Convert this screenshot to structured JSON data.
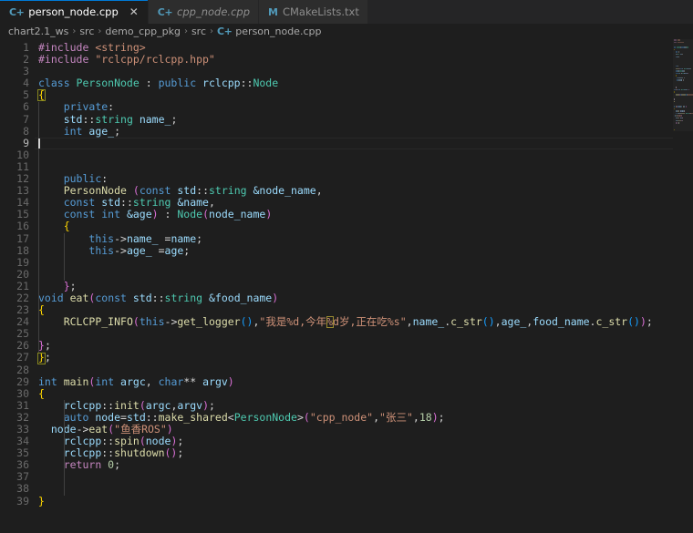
{
  "tabs": [
    {
      "label": "person_node.cpp",
      "icon": "cpp-file-icon",
      "icon_glyph": "C+",
      "active": true,
      "italic": false,
      "close": "✕"
    },
    {
      "label": "cpp_node.cpp",
      "icon": "cpp-file-icon",
      "icon_glyph": "C+",
      "active": false,
      "italic": true,
      "close": ""
    },
    {
      "label": "CMakeLists.txt",
      "icon": "cmake-file-icon",
      "icon_glyph": "M",
      "active": false,
      "italic": false,
      "close": ""
    }
  ],
  "breadcrumb": {
    "separator": "›",
    "items": [
      {
        "label": "chart2.1_ws",
        "icon": ""
      },
      {
        "label": "src",
        "icon": ""
      },
      {
        "label": "demo_cpp_pkg",
        "icon": ""
      },
      {
        "label": "src",
        "icon": ""
      },
      {
        "label": "person_node.cpp",
        "icon": "cpp-file-icon"
      }
    ]
  },
  "editor": {
    "language": "cpp",
    "file_name": "person_node.cpp",
    "current_line": 9,
    "total_lines": 39,
    "lines": [
      {
        "n": 1,
        "tokens": [
          {
            "t": "#include ",
            "c": "c-pre"
          },
          {
            "t": "<string>",
            "c": "c-str"
          }
        ]
      },
      {
        "n": 2,
        "tokens": [
          {
            "t": "#include ",
            "c": "c-pre"
          },
          {
            "t": "\"rclcpp/rclcpp.hpp\"",
            "c": "c-str"
          }
        ]
      },
      {
        "n": 3,
        "tokens": []
      },
      {
        "n": 4,
        "tokens": [
          {
            "t": "class ",
            "c": "c-key"
          },
          {
            "t": "PersonNode ",
            "c": "c-type"
          },
          {
            "t": ": ",
            "c": "c-plain"
          },
          {
            "t": "public ",
            "c": "c-key"
          },
          {
            "t": "rclcpp",
            "c": "c-id"
          },
          {
            "t": "::",
            "c": "c-plain"
          },
          {
            "t": "Node",
            "c": "c-type"
          }
        ]
      },
      {
        "n": 5,
        "tokens": [
          {
            "t": "{",
            "c": "c-brace"
          }
        ]
      },
      {
        "n": 6,
        "tokens": [
          {
            "t": "    ",
            "c": "c-plain"
          },
          {
            "t": "private",
            "c": "c-key"
          },
          {
            "t": ":",
            "c": "c-plain"
          }
        ]
      },
      {
        "n": 7,
        "tokens": [
          {
            "t": "    ",
            "c": "c-plain"
          },
          {
            "t": "std",
            "c": "c-id"
          },
          {
            "t": "::",
            "c": "c-plain"
          },
          {
            "t": "string ",
            "c": "c-type"
          },
          {
            "t": "name_",
            "c": "c-id"
          },
          {
            "t": ";",
            "c": "c-plain"
          }
        ]
      },
      {
        "n": 8,
        "tokens": [
          {
            "t": "    ",
            "c": "c-plain"
          },
          {
            "t": "int ",
            "c": "c-key"
          },
          {
            "t": "age_",
            "c": "c-id"
          },
          {
            "t": ";",
            "c": "c-plain"
          }
        ]
      },
      {
        "n": 9,
        "tokens": []
      },
      {
        "n": 10,
        "tokens": []
      },
      {
        "n": 11,
        "tokens": []
      },
      {
        "n": 12,
        "tokens": [
          {
            "t": "    ",
            "c": "c-plain"
          },
          {
            "t": "public",
            "c": "c-key"
          },
          {
            "t": ":",
            "c": "c-plain"
          }
        ]
      },
      {
        "n": 13,
        "tokens": [
          {
            "t": "    ",
            "c": "c-plain"
          },
          {
            "t": "PersonNode ",
            "c": "c-fn"
          },
          {
            "t": "(",
            "c": "c-paren"
          },
          {
            "t": "const ",
            "c": "c-key"
          },
          {
            "t": "std",
            "c": "c-id"
          },
          {
            "t": "::",
            "c": "c-plain"
          },
          {
            "t": "string ",
            "c": "c-type"
          },
          {
            "t": "&node_name",
            "c": "c-id"
          },
          {
            "t": ",",
            "c": "c-plain"
          }
        ]
      },
      {
        "n": 14,
        "tokens": [
          {
            "t": "    ",
            "c": "c-plain"
          },
          {
            "t": "const ",
            "c": "c-key"
          },
          {
            "t": "std",
            "c": "c-id"
          },
          {
            "t": "::",
            "c": "c-plain"
          },
          {
            "t": "string ",
            "c": "c-type"
          },
          {
            "t": "&name",
            "c": "c-id"
          },
          {
            "t": ",",
            "c": "c-plain"
          }
        ]
      },
      {
        "n": 15,
        "tokens": [
          {
            "t": "    ",
            "c": "c-plain"
          },
          {
            "t": "const ",
            "c": "c-key"
          },
          {
            "t": "int ",
            "c": "c-key"
          },
          {
            "t": "&age",
            "c": "c-id"
          },
          {
            "t": ") ",
            "c": "c-paren"
          },
          {
            "t": ": ",
            "c": "c-plain"
          },
          {
            "t": "Node",
            "c": "c-type"
          },
          {
            "t": "(",
            "c": "c-paren"
          },
          {
            "t": "node_name",
            "c": "c-id"
          },
          {
            "t": ")",
            "c": "c-paren"
          }
        ]
      },
      {
        "n": 16,
        "tokens": [
          {
            "t": "    ",
            "c": "c-plain"
          },
          {
            "t": "{",
            "c": "c-brace"
          }
        ]
      },
      {
        "n": 17,
        "tokens": [
          {
            "t": "        ",
            "c": "c-plain"
          },
          {
            "t": "this",
            "c": "c-key"
          },
          {
            "t": "->",
            "c": "c-plain"
          },
          {
            "t": "name_ ",
            "c": "c-id"
          },
          {
            "t": "=",
            "c": "c-plain"
          },
          {
            "t": "name",
            "c": "c-id"
          },
          {
            "t": ";",
            "c": "c-plain"
          }
        ]
      },
      {
        "n": 18,
        "tokens": [
          {
            "t": "        ",
            "c": "c-plain"
          },
          {
            "t": "this",
            "c": "c-key"
          },
          {
            "t": "->",
            "c": "c-plain"
          },
          {
            "t": "age_ ",
            "c": "c-id"
          },
          {
            "t": "=",
            "c": "c-plain"
          },
          {
            "t": "age",
            "c": "c-id"
          },
          {
            "t": ";",
            "c": "c-plain"
          }
        ]
      },
      {
        "n": 19,
        "tokens": []
      },
      {
        "n": 20,
        "tokens": []
      },
      {
        "n": 21,
        "tokens": [
          {
            "t": "    ",
            "c": "c-plain"
          },
          {
            "t": "}",
            "c": "c-paren"
          },
          {
            "t": ";",
            "c": "c-plain"
          }
        ]
      },
      {
        "n": 22,
        "tokens": [
          {
            "t": "void ",
            "c": "c-key"
          },
          {
            "t": "eat",
            "c": "c-fn"
          },
          {
            "t": "(",
            "c": "c-paren"
          },
          {
            "t": "const ",
            "c": "c-key"
          },
          {
            "t": "std",
            "c": "c-id"
          },
          {
            "t": "::",
            "c": "c-plain"
          },
          {
            "t": "string ",
            "c": "c-type"
          },
          {
            "t": "&food_name",
            "c": "c-id"
          },
          {
            "t": ")",
            "c": "c-paren"
          }
        ]
      },
      {
        "n": 23,
        "tokens": [
          {
            "t": "{",
            "c": "c-brace"
          }
        ]
      },
      {
        "n": 24,
        "tokens": [
          {
            "t": "    ",
            "c": "c-plain"
          },
          {
            "t": "RCLCPP_INFO",
            "c": "c-macro"
          },
          {
            "t": "(",
            "c": "c-paren"
          },
          {
            "t": "this",
            "c": "c-key"
          },
          {
            "t": "->",
            "c": "c-plain"
          },
          {
            "t": "get_logger",
            "c": "c-fn"
          },
          {
            "t": "()",
            "c": "c-paren2"
          },
          {
            "t": ",",
            "c": "c-plain"
          },
          {
            "t": "\"我是%d,今年%d岁,正在吃%s\"",
            "c": "c-str"
          },
          {
            "t": ",",
            "c": "c-plain"
          },
          {
            "t": "name_",
            "c": "c-id"
          },
          {
            "t": ".",
            "c": "c-plain"
          },
          {
            "t": "c_str",
            "c": "c-fn"
          },
          {
            "t": "()",
            "c": "c-paren2"
          },
          {
            "t": ",",
            "c": "c-plain"
          },
          {
            "t": "age_",
            "c": "c-id"
          },
          {
            "t": ",",
            "c": "c-plain"
          },
          {
            "t": "food_name",
            "c": "c-id"
          },
          {
            "t": ".",
            "c": "c-plain"
          },
          {
            "t": "c_str",
            "c": "c-fn"
          },
          {
            "t": "()",
            "c": "c-paren2"
          },
          {
            "t": ")",
            "c": "c-paren"
          },
          {
            "t": ";",
            "c": "c-plain"
          }
        ]
      },
      {
        "n": 25,
        "tokens": []
      },
      {
        "n": 26,
        "tokens": [
          {
            "t": "}",
            "c": "c-paren"
          },
          {
            "t": ";",
            "c": "c-plain"
          }
        ]
      },
      {
        "n": 27,
        "tokens": [
          {
            "t": "}",
            "c": "c-brace"
          },
          {
            "t": ";",
            "c": "c-plain"
          }
        ]
      },
      {
        "n": 28,
        "tokens": []
      },
      {
        "n": 29,
        "tokens": [
          {
            "t": "int ",
            "c": "c-key"
          },
          {
            "t": "main",
            "c": "c-fn"
          },
          {
            "t": "(",
            "c": "c-paren"
          },
          {
            "t": "int ",
            "c": "c-key"
          },
          {
            "t": "argc",
            "c": "c-id"
          },
          {
            "t": ", ",
            "c": "c-plain"
          },
          {
            "t": "char",
            "c": "c-key"
          },
          {
            "t": "** ",
            "c": "c-plain"
          },
          {
            "t": "argv",
            "c": "c-id"
          },
          {
            "t": ")",
            "c": "c-paren"
          }
        ]
      },
      {
        "n": 30,
        "tokens": [
          {
            "t": "{",
            "c": "c-brace"
          }
        ]
      },
      {
        "n": 31,
        "tokens": [
          {
            "t": "    ",
            "c": "c-plain"
          },
          {
            "t": "rclcpp",
            "c": "c-id"
          },
          {
            "t": "::",
            "c": "c-plain"
          },
          {
            "t": "init",
            "c": "c-fn"
          },
          {
            "t": "(",
            "c": "c-paren"
          },
          {
            "t": "argc",
            "c": "c-id"
          },
          {
            "t": ",",
            "c": "c-plain"
          },
          {
            "t": "argv",
            "c": "c-id"
          },
          {
            "t": ")",
            "c": "c-paren"
          },
          {
            "t": ";",
            "c": "c-plain"
          }
        ]
      },
      {
        "n": 32,
        "tokens": [
          {
            "t": "    ",
            "c": "c-plain"
          },
          {
            "t": "auto ",
            "c": "c-key"
          },
          {
            "t": "node",
            "c": "c-id"
          },
          {
            "t": "=",
            "c": "c-plain"
          },
          {
            "t": "std",
            "c": "c-id"
          },
          {
            "t": "::",
            "c": "c-plain"
          },
          {
            "t": "make_shared",
            "c": "c-fn"
          },
          {
            "t": "<",
            "c": "c-plain"
          },
          {
            "t": "PersonNode",
            "c": "c-type"
          },
          {
            "t": ">",
            "c": "c-plain"
          },
          {
            "t": "(",
            "c": "c-paren"
          },
          {
            "t": "\"cpp_node\"",
            "c": "c-str"
          },
          {
            "t": ",",
            "c": "c-plain"
          },
          {
            "t": "\"张三\"",
            "c": "c-str"
          },
          {
            "t": ",",
            "c": "c-plain"
          },
          {
            "t": "18",
            "c": "c-num"
          },
          {
            "t": ")",
            "c": "c-paren"
          },
          {
            "t": ";",
            "c": "c-plain"
          }
        ]
      },
      {
        "n": 33,
        "tokens": [
          {
            "t": "  ",
            "c": "c-plain"
          },
          {
            "t": "node",
            "c": "c-id"
          },
          {
            "t": "->",
            "c": "c-plain"
          },
          {
            "t": "eat",
            "c": "c-fn"
          },
          {
            "t": "(",
            "c": "c-paren"
          },
          {
            "t": "\"鱼香ROS\"",
            "c": "c-str"
          },
          {
            "t": ")",
            "c": "c-paren"
          }
        ]
      },
      {
        "n": 34,
        "tokens": [
          {
            "t": "    ",
            "c": "c-plain"
          },
          {
            "t": "rclcpp",
            "c": "c-id"
          },
          {
            "t": "::",
            "c": "c-plain"
          },
          {
            "t": "spin",
            "c": "c-fn"
          },
          {
            "t": "(",
            "c": "c-paren"
          },
          {
            "t": "node",
            "c": "c-id"
          },
          {
            "t": ")",
            "c": "c-paren"
          },
          {
            "t": ";",
            "c": "c-plain"
          }
        ]
      },
      {
        "n": 35,
        "tokens": [
          {
            "t": "    ",
            "c": "c-plain"
          },
          {
            "t": "rclcpp",
            "c": "c-id"
          },
          {
            "t": "::",
            "c": "c-plain"
          },
          {
            "t": "shutdown",
            "c": "c-fn"
          },
          {
            "t": "()",
            "c": "c-paren"
          },
          {
            "t": ";",
            "c": "c-plain"
          }
        ]
      },
      {
        "n": 36,
        "tokens": [
          {
            "t": "    ",
            "c": "c-plain"
          },
          {
            "t": "return ",
            "c": "c-ctrl"
          },
          {
            "t": "0",
            "c": "c-num"
          },
          {
            "t": ";",
            "c": "c-plain"
          }
        ]
      },
      {
        "n": 37,
        "tokens": []
      },
      {
        "n": 38,
        "tokens": []
      },
      {
        "n": 39,
        "tokens": [
          {
            "t": "}",
            "c": "c-brace"
          }
        ]
      }
    ]
  },
  "theme": {
    "editor_background": "#1e1e1e",
    "tabbar_background": "#252526",
    "inactive_tab_background": "#2d2d2d",
    "active_tab_border": "#0078d4",
    "line_number": "#6a6a6a",
    "keyword": "#569cd6",
    "type": "#4ec9b0",
    "string": "#ce9178",
    "number": "#b5cea8",
    "function": "#dcdcaa",
    "variable": "#9cdcfe",
    "preprocessor": "#c586c0",
    "brace_yellow": "#ffd700",
    "brace_magenta": "#da70d6",
    "brace_blue": "#179fff"
  }
}
